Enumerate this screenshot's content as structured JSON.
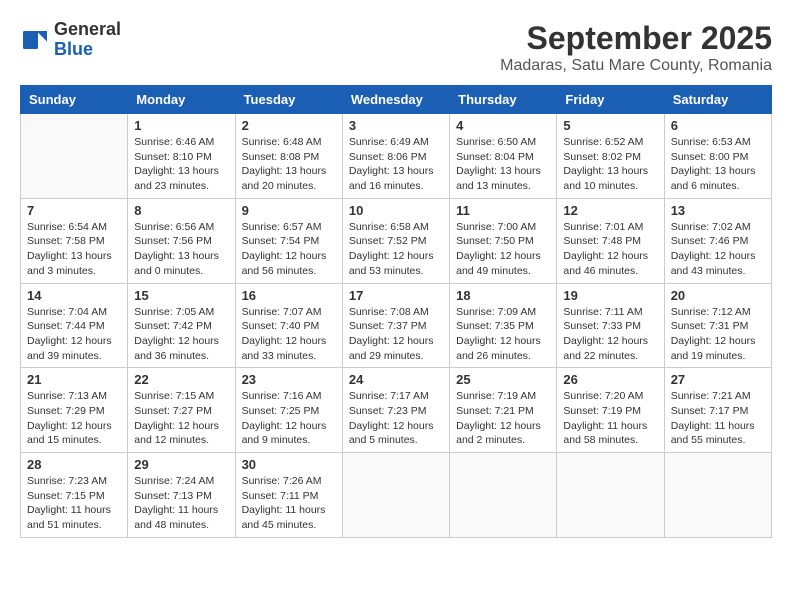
{
  "logo": {
    "general": "General",
    "blue": "Blue"
  },
  "title": "September 2025",
  "location": "Madaras, Satu Mare County, Romania",
  "days_header": [
    "Sunday",
    "Monday",
    "Tuesday",
    "Wednesday",
    "Thursday",
    "Friday",
    "Saturday"
  ],
  "weeks": [
    [
      {
        "day": "",
        "info": ""
      },
      {
        "day": "1",
        "info": "Sunrise: 6:46 AM\nSunset: 8:10 PM\nDaylight: 13 hours and 23 minutes."
      },
      {
        "day": "2",
        "info": "Sunrise: 6:48 AM\nSunset: 8:08 PM\nDaylight: 13 hours and 20 minutes."
      },
      {
        "day": "3",
        "info": "Sunrise: 6:49 AM\nSunset: 8:06 PM\nDaylight: 13 hours and 16 minutes."
      },
      {
        "day": "4",
        "info": "Sunrise: 6:50 AM\nSunset: 8:04 PM\nDaylight: 13 hours and 13 minutes."
      },
      {
        "day": "5",
        "info": "Sunrise: 6:52 AM\nSunset: 8:02 PM\nDaylight: 13 hours and 10 minutes."
      },
      {
        "day": "6",
        "info": "Sunrise: 6:53 AM\nSunset: 8:00 PM\nDaylight: 13 hours and 6 minutes."
      }
    ],
    [
      {
        "day": "7",
        "info": "Sunrise: 6:54 AM\nSunset: 7:58 PM\nDaylight: 13 hours and 3 minutes."
      },
      {
        "day": "8",
        "info": "Sunrise: 6:56 AM\nSunset: 7:56 PM\nDaylight: 13 hours and 0 minutes."
      },
      {
        "day": "9",
        "info": "Sunrise: 6:57 AM\nSunset: 7:54 PM\nDaylight: 12 hours and 56 minutes."
      },
      {
        "day": "10",
        "info": "Sunrise: 6:58 AM\nSunset: 7:52 PM\nDaylight: 12 hours and 53 minutes."
      },
      {
        "day": "11",
        "info": "Sunrise: 7:00 AM\nSunset: 7:50 PM\nDaylight: 12 hours and 49 minutes."
      },
      {
        "day": "12",
        "info": "Sunrise: 7:01 AM\nSunset: 7:48 PM\nDaylight: 12 hours and 46 minutes."
      },
      {
        "day": "13",
        "info": "Sunrise: 7:02 AM\nSunset: 7:46 PM\nDaylight: 12 hours and 43 minutes."
      }
    ],
    [
      {
        "day": "14",
        "info": "Sunrise: 7:04 AM\nSunset: 7:44 PM\nDaylight: 12 hours and 39 minutes."
      },
      {
        "day": "15",
        "info": "Sunrise: 7:05 AM\nSunset: 7:42 PM\nDaylight: 12 hours and 36 minutes."
      },
      {
        "day": "16",
        "info": "Sunrise: 7:07 AM\nSunset: 7:40 PM\nDaylight: 12 hours and 33 minutes."
      },
      {
        "day": "17",
        "info": "Sunrise: 7:08 AM\nSunset: 7:37 PM\nDaylight: 12 hours and 29 minutes."
      },
      {
        "day": "18",
        "info": "Sunrise: 7:09 AM\nSunset: 7:35 PM\nDaylight: 12 hours and 26 minutes."
      },
      {
        "day": "19",
        "info": "Sunrise: 7:11 AM\nSunset: 7:33 PM\nDaylight: 12 hours and 22 minutes."
      },
      {
        "day": "20",
        "info": "Sunrise: 7:12 AM\nSunset: 7:31 PM\nDaylight: 12 hours and 19 minutes."
      }
    ],
    [
      {
        "day": "21",
        "info": "Sunrise: 7:13 AM\nSunset: 7:29 PM\nDaylight: 12 hours and 15 minutes."
      },
      {
        "day": "22",
        "info": "Sunrise: 7:15 AM\nSunset: 7:27 PM\nDaylight: 12 hours and 12 minutes."
      },
      {
        "day": "23",
        "info": "Sunrise: 7:16 AM\nSunset: 7:25 PM\nDaylight: 12 hours and 9 minutes."
      },
      {
        "day": "24",
        "info": "Sunrise: 7:17 AM\nSunset: 7:23 PM\nDaylight: 12 hours and 5 minutes."
      },
      {
        "day": "25",
        "info": "Sunrise: 7:19 AM\nSunset: 7:21 PM\nDaylight: 12 hours and 2 minutes."
      },
      {
        "day": "26",
        "info": "Sunrise: 7:20 AM\nSunset: 7:19 PM\nDaylight: 11 hours and 58 minutes."
      },
      {
        "day": "27",
        "info": "Sunrise: 7:21 AM\nSunset: 7:17 PM\nDaylight: 11 hours and 55 minutes."
      }
    ],
    [
      {
        "day": "28",
        "info": "Sunrise: 7:23 AM\nSunset: 7:15 PM\nDaylight: 11 hours and 51 minutes."
      },
      {
        "day": "29",
        "info": "Sunrise: 7:24 AM\nSunset: 7:13 PM\nDaylight: 11 hours and 48 minutes."
      },
      {
        "day": "30",
        "info": "Sunrise: 7:26 AM\nSunset: 7:11 PM\nDaylight: 11 hours and 45 minutes."
      },
      {
        "day": "",
        "info": ""
      },
      {
        "day": "",
        "info": ""
      },
      {
        "day": "",
        "info": ""
      },
      {
        "day": "",
        "info": ""
      }
    ]
  ]
}
